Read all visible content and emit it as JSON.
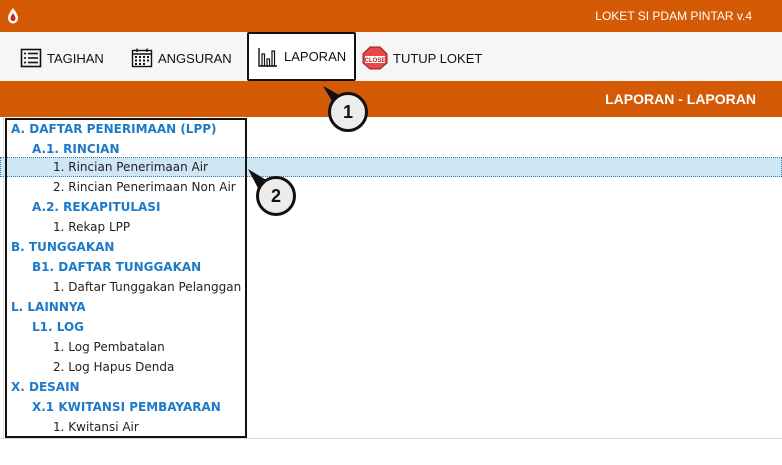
{
  "app": {
    "title": "LOKET SI PDAM PINTAR v.4"
  },
  "toolbar": {
    "buttons": [
      {
        "label": "TAGIHAN",
        "icon": "list-icon"
      },
      {
        "label": "ANGSURAN",
        "icon": "calendar-icon"
      },
      {
        "label": "LAPORAN",
        "icon": "bar-chart-icon",
        "active": true
      },
      {
        "label": "TUTUP LOKET",
        "icon": "close-sign-icon",
        "icon_text": "CLOSE"
      }
    ]
  },
  "header": {
    "title": "LAPORAN - LAPORAN"
  },
  "tree": [
    {
      "label": "A. DAFTAR PENERIMAAN (LPP)",
      "level": 0,
      "category": true
    },
    {
      "label": "A.1. RINCIAN",
      "level": 1,
      "category": true
    },
    {
      "label": "1. Rincian Penerimaan Air",
      "level": 2,
      "selected": true
    },
    {
      "label": "2. Rincian Penerimaan Non Air",
      "level": 2
    },
    {
      "label": "A.2. REKAPITULASI",
      "level": 1,
      "category": true
    },
    {
      "label": "1. Rekap LPP",
      "level": 2
    },
    {
      "label": "B. TUNGGAKAN",
      "level": 0,
      "category": true
    },
    {
      "label": "B1. DAFTAR TUNGGAKAN",
      "level": 1,
      "category": true
    },
    {
      "label": "1. Daftar Tunggakan Pelanggan",
      "level": 2
    },
    {
      "label": "L. LAINNYA",
      "level": 0,
      "category": true
    },
    {
      "label": "L1. LOG",
      "level": 1,
      "category": true
    },
    {
      "label": "1. Log Pembatalan",
      "level": 2
    },
    {
      "label": "2. Log Hapus Denda",
      "level": 2
    },
    {
      "label": "X. DESAIN",
      "level": 0,
      "category": true
    },
    {
      "label": "X.1 KWITANSI PEMBAYARAN",
      "level": 1,
      "category": true
    },
    {
      "label": "1. Kwitansi Air",
      "level": 2
    }
  ],
  "callouts": [
    {
      "number": "1"
    },
    {
      "number": "2"
    }
  ],
  "colors": {
    "brand_orange": "#d45a06",
    "category_blue": "#1e7ac8",
    "selection": "#cfe6f4"
  }
}
